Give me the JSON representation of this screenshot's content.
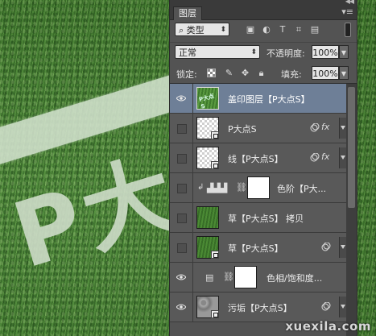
{
  "canvas": {
    "artwork_text": "P大",
    "watermark": "xuexila.com"
  },
  "panel": {
    "tab_label": "图层",
    "menu_icon": "panel-menu-icon",
    "filter": {
      "selected": "类型",
      "search_icon": "search-icon",
      "icons": [
        "image-filter-icon",
        "adjustment-filter-icon",
        "type-filter-icon",
        "shape-filter-icon",
        "smart-object-filter-icon"
      ]
    },
    "blend_mode": "正常",
    "opacity_label": "不透明度:",
    "opacity_value": "100%",
    "lock_label": "锁定:",
    "lock_icons": [
      "lock-transparency-icon",
      "lock-image-icon",
      "lock-position-icon",
      "lock-all-icon"
    ],
    "fill_label": "填充:",
    "fill_value": "100%"
  },
  "layers": [
    {
      "name": "盖印图层【P大点S】",
      "visible": true,
      "selected": true,
      "thumb": "selected-grass",
      "fx": false
    },
    {
      "name": "P大点S",
      "visible": false,
      "selected": false,
      "thumb": "checker",
      "smart": true,
      "filter": true,
      "fx": true,
      "fx_label": "fx"
    },
    {
      "name": "线【P大点S】",
      "visible": false,
      "selected": false,
      "thumb": "checker",
      "smart": true,
      "filter": true,
      "fx": true,
      "fx_label": "fx"
    },
    {
      "name": "色阶【P大...",
      "visible": false,
      "selected": false,
      "adjustment": "levels",
      "mask": true,
      "clipped": true
    },
    {
      "name": "草【P大点S】 拷贝",
      "visible": false,
      "selected": false,
      "thumb": "grass"
    },
    {
      "name": "草【P大点S】",
      "visible": false,
      "selected": false,
      "thumb": "grass",
      "smart": true,
      "filter": true
    },
    {
      "name": "色相/饱和度...",
      "visible": true,
      "selected": false,
      "adjustment": "hue-saturation",
      "mask": true
    },
    {
      "name": "污垢【P大点S】",
      "visible": true,
      "selected": false,
      "thumb": "noise",
      "smart": true,
      "filter": true
    }
  ]
}
